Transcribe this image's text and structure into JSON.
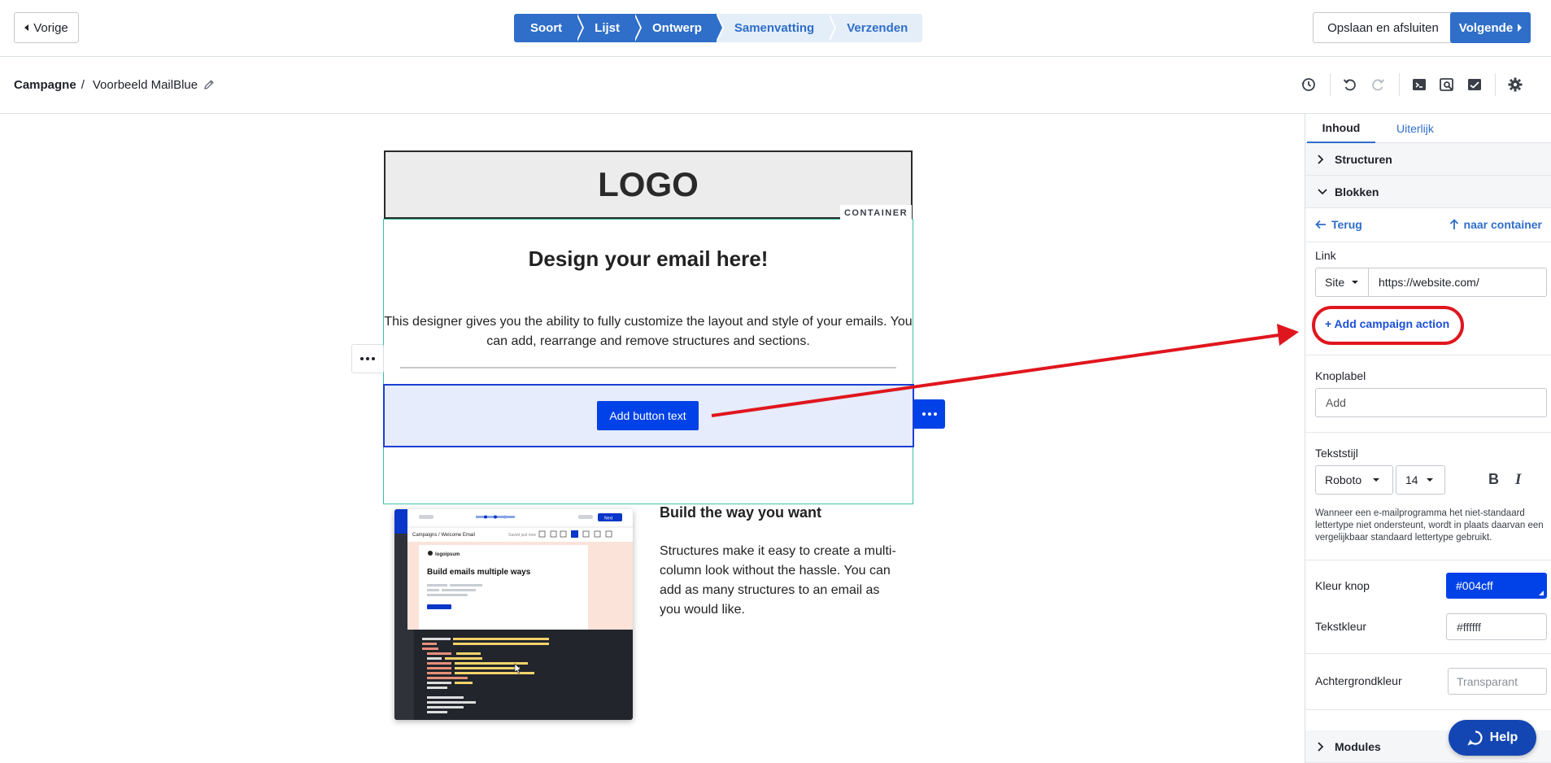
{
  "topbar": {
    "prev_label": "Vorige",
    "save_label": "Opslaan en afsluiten",
    "next_label": "Volgende",
    "steps": [
      {
        "label": "Soort",
        "state": "done"
      },
      {
        "label": "Lijst",
        "state": "done"
      },
      {
        "label": "Ontwerp",
        "state": "done"
      },
      {
        "label": "Samenvatting",
        "state": "todo"
      },
      {
        "label": "Verzenden",
        "state": "todo"
      }
    ]
  },
  "breadcrumb": {
    "root": "Campagne",
    "separator": "/",
    "current": "Voorbeeld MailBlue"
  },
  "toolbar_icons": [
    "history-icon",
    "undo-icon",
    "redo-icon",
    "code-icon",
    "preview-icon",
    "test-email-icon",
    "settings-icon"
  ],
  "email": {
    "logo_text": "LOGO",
    "container_tag": "CONTAINER",
    "heading": "Design your email here!",
    "intro": "This designer gives you the ability to fully customize the layout and style of your emails. You can add, rearrange and remove structures and sections.",
    "button_text": "Add button text",
    "build_title": "Build the way you want",
    "build_text": "Structures make it easy to create a multi-column look without the hassle. You can add as many structures to an email as you would like.",
    "preview": {
      "breadcrumb": "Campaigns / Welcome Email",
      "saved": "Saved just now",
      "next": "Next",
      "logo": "logoipsum",
      "title": "Build emails multiple ways"
    }
  },
  "panel": {
    "tabs": [
      {
        "label": "Inhoud",
        "active": true
      },
      {
        "label": "Uiterlijk",
        "active": false
      }
    ],
    "sections": {
      "structures": "Structuren",
      "blocks": "Blokken",
      "modules": "Modules"
    },
    "back_label": "Terug",
    "to_container_label": "naar container",
    "link_label": "Link",
    "link_type": "Site",
    "link_url": "https://website.com/",
    "add_campaign_action": "+ Add campaign action",
    "button_label_label": "Knoplabel",
    "button_label_value": "Add",
    "text_style_label": "Tekststijl",
    "font": "Roboto",
    "font_size": "14",
    "bold_label": "B",
    "italic_label": "I",
    "font_note": "Wanneer een e-mailprogramma het niet-standaard lettertype niet ondersteunt, wordt in plaats daarvan een vergelijkbaar standaard lettertype gebruikt.",
    "button_color_label": "Kleur knop",
    "button_color_value": "#004cff",
    "text_color_label": "Tekstkleur",
    "text_color_value": "#ffffff",
    "bg_color_label": "Achtergrondkleur",
    "bg_color_placeholder": "Transparant"
  },
  "help_label": "Help",
  "colors": {
    "accent": "#2f6ec9",
    "email_button": "#0042e8",
    "annotation": "#e0161e",
    "container_outline": "#3bc2a4"
  }
}
